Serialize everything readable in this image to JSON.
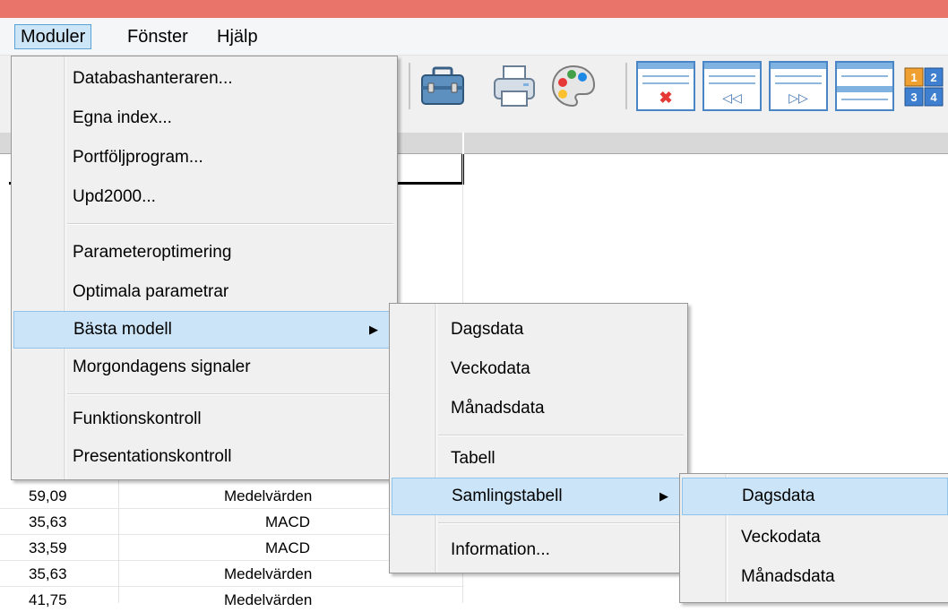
{
  "menubar": {
    "items": [
      {
        "label": "Moduler"
      },
      {
        "label": "Fönster"
      },
      {
        "label": "Hjälp"
      }
    ]
  },
  "toolbar": {
    "icons": [
      "briefcase-icon",
      "printer-icon",
      "palette-icon",
      "close-window-icon",
      "previous-window-icon",
      "next-window-icon",
      "tile-windows-icon",
      "numbered-grid-icon"
    ],
    "grid_icon_digits": [
      "1",
      "2",
      "3",
      "4"
    ]
  },
  "grid": {
    "rows": [
      {
        "value": "59,09",
        "name": "Medelvärden"
      },
      {
        "value": "35,63",
        "name": "MACD"
      },
      {
        "value": "33,59",
        "name": "MACD"
      },
      {
        "value": "35,63",
        "name": "Medelvärden"
      },
      {
        "value": "41,75",
        "name": "Medelvärden"
      }
    ]
  },
  "menus": {
    "moduler": {
      "items": [
        {
          "label": "Databashanteraren..."
        },
        {
          "label": "Egna index..."
        },
        {
          "label": "Portföljprogram..."
        },
        {
          "label": "Upd2000..."
        },
        {
          "label": "Parameteroptimering"
        },
        {
          "label": "Optimala parametrar"
        },
        {
          "label": "Bästa modell"
        },
        {
          "label": "Morgondagens signaler"
        },
        {
          "label": "Funktionskontroll"
        },
        {
          "label": "Presentationskontroll"
        }
      ]
    },
    "basta_modell": {
      "items": [
        {
          "label": "Dagsdata"
        },
        {
          "label": "Veckodata"
        },
        {
          "label": "Månadsdata"
        },
        {
          "label": "Tabell"
        },
        {
          "label": "Samlingstabell"
        },
        {
          "label": "Information..."
        }
      ]
    },
    "samlingstabell": {
      "items": [
        {
          "label": "Dagsdata"
        },
        {
          "label": "Veckodata"
        },
        {
          "label": "Månadsdata"
        }
      ]
    }
  },
  "colors": {
    "title_bar": "#e8746a",
    "highlight": "#cce4f7",
    "highlight_border": "#8ec3eb",
    "menu_bg": "#f0f0f0"
  }
}
